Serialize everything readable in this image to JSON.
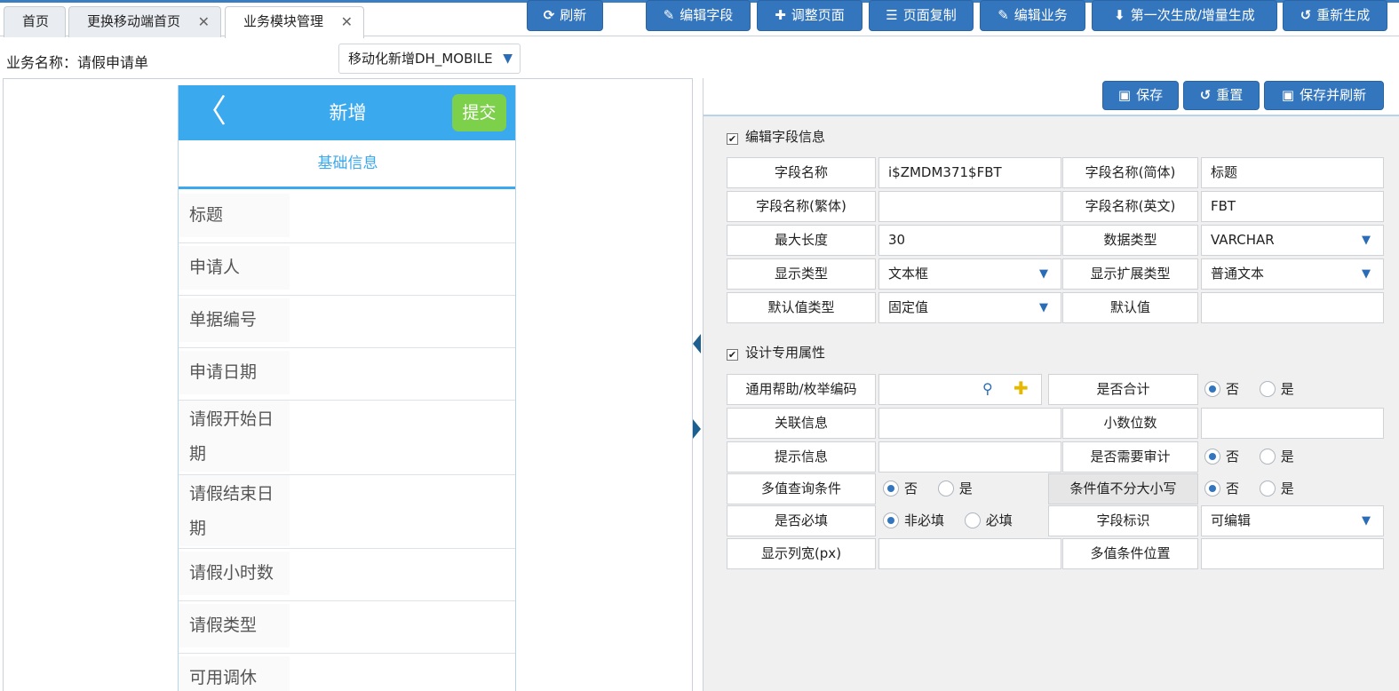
{
  "tabs": [
    {
      "label": "首页",
      "closable": false
    },
    {
      "label": "更换移动端首页",
      "closable": true
    },
    {
      "label": "业务模块管理",
      "closable": true,
      "active": true
    }
  ],
  "toolbar": {
    "business_name": "业务名称：请假申请单",
    "page_select": "移动化新增DH_MOBILE",
    "refresh": "刷新",
    "edit_field": "编辑字段",
    "adjust_page": "调整页面",
    "copy_page": "页面复制",
    "edit_business": "编辑业务",
    "generate": "第一次生成/增量生成",
    "regenerate": "重新生成"
  },
  "right_toolbar": {
    "save": "保存",
    "reset": "重置",
    "save_refresh": "保存并刷新"
  },
  "phone": {
    "back": "〈",
    "title": "新增",
    "submit": "提交",
    "section": "基础信息",
    "fields": [
      "标题",
      "申请人",
      "单据编号",
      "申请日期",
      "请假开始日期",
      "请假结束日期",
      "请假小时数",
      "请假类型",
      "可用调休"
    ]
  },
  "field_info": {
    "section_title": "编辑字段信息",
    "field_name_label": "字段名称",
    "field_name_value": "i$ZMDM371$FBT",
    "name_cn_label": "字段名称(简体)",
    "name_cn_value": "标题",
    "name_tw_label": "字段名称(繁体)",
    "name_tw_value": "",
    "name_en_label": "字段名称(英文)",
    "name_en_value": "FBT",
    "max_len_label": "最大长度",
    "max_len_value": "30",
    "data_type_label": "数据类型",
    "data_type_value": "VARCHAR",
    "display_type_label": "显示类型",
    "display_type_value": "文本框",
    "display_ext_label": "显示扩展类型",
    "display_ext_value": "普通文本",
    "default_type_label": "默认值类型",
    "default_type_value": "固定值",
    "default_value_label": "默认值",
    "default_value_value": ""
  },
  "design_props": {
    "section_title": "设计专用属性",
    "help_code_label": "通用帮助/枚举编码",
    "help_code_value": "",
    "is_sum_label": "是否合计",
    "related_label": "关联信息",
    "decimals_label": "小数位数",
    "hint_label": "提示信息",
    "audit_label": "是否需要审计",
    "multi_query_label": "多值查询条件",
    "case_label": "条件值不分大小写",
    "required_label": "是否必填",
    "field_flag_label": "字段标识",
    "field_flag_value": "可编辑",
    "col_width_label": "显示列宽(px)",
    "multi_pos_label": "多值条件位置",
    "no": "否",
    "yes": "是",
    "not_required": "非必填",
    "required": "必填"
  },
  "colors": {
    "button": "#3476bd",
    "phone_header": "#3ba9ee",
    "submit_button": "#7dd04a"
  }
}
